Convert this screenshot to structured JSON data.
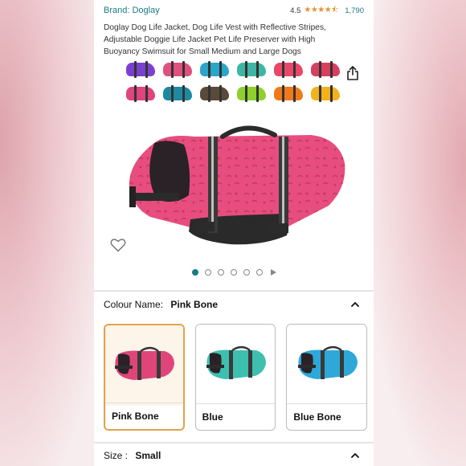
{
  "header": {
    "brand": "Brand: Doglay",
    "rating_value": "4.5",
    "stars": "★★★★⯪",
    "rating_count": "1,790"
  },
  "product": {
    "title": "Doglay Dog Life Jacket, Dog Life Vest with Reflective Stripes, Adjustable Doggie Life Jacket Pet Life Preserver with High Buoyancy Swimsuit for Small Medium and Large Dogs"
  },
  "swatch_colors": [
    "#7b3fd0",
    "#e0507e",
    "#2aa6c8",
    "#3fb5a5",
    "#e8476a",
    "#d6405e",
    "#e0447c",
    "#1d8aa0",
    "#5a4a3a",
    "#8ed12a",
    "#f07a1a",
    "#f2b21c"
  ],
  "carousel": {
    "dot_count": 6,
    "active_index": 0
  },
  "colour": {
    "label": "Colour Name:",
    "value": "Pink Bone",
    "options": [
      {
        "name": "Pink Bone",
        "color": "#e0457a"
      },
      {
        "name": "Blue",
        "color": "#3ec0b0"
      },
      {
        "name": "Blue Bone",
        "color": "#2ea8d8"
      }
    ]
  },
  "size": {
    "label": "Size :",
    "value": "Small"
  },
  "colors": {
    "accent_teal": "#137d85",
    "selected_border": "#e3a24a",
    "star_orange": "#e8912d"
  }
}
